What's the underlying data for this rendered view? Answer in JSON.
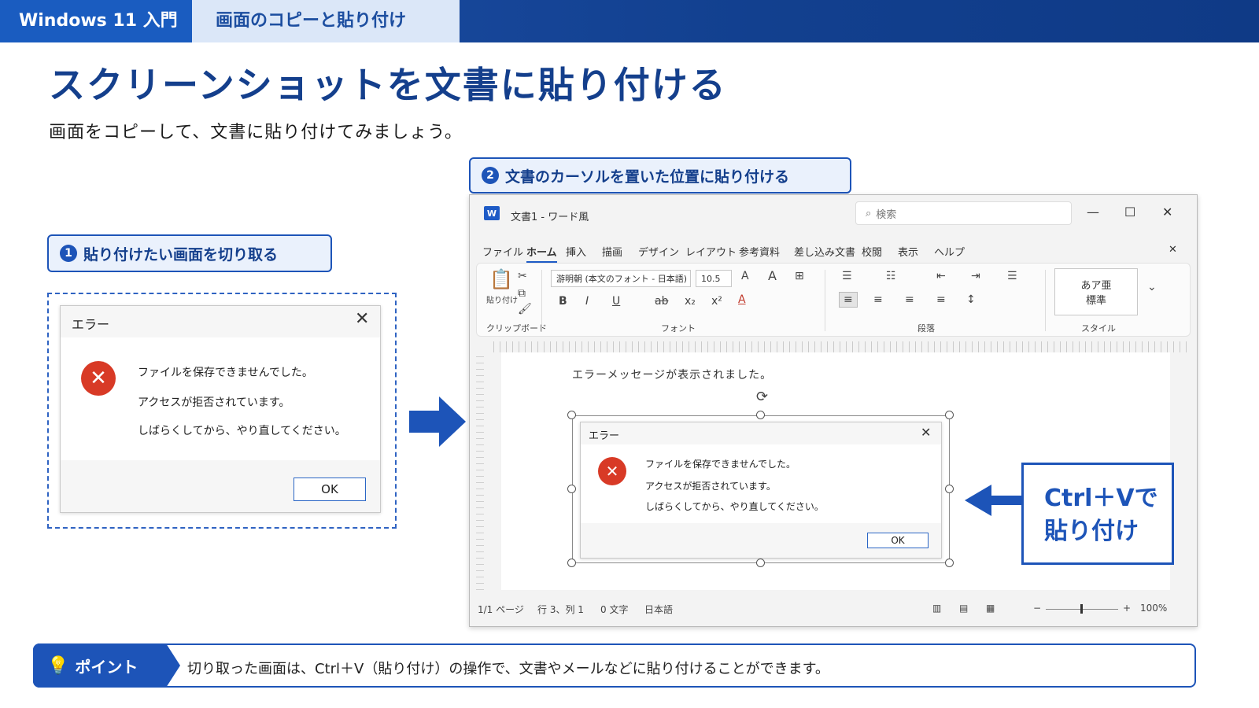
{
  "header": {
    "series": "Windows 11 入門",
    "topic": "画面のコピーと貼り付け"
  },
  "title": "スクリーンショットを文書に貼り付ける",
  "subtitle": "画面をコピーして、文書に貼り付けてみましょう。",
  "step1": {
    "num": "1",
    "label": "貼り付けたい画面を切り取る"
  },
  "step2": {
    "num": "2",
    "label": "文書のカーソルを置いた位置に貼り付ける"
  },
  "error_dialog": {
    "title": "エラー",
    "lines": [
      "ファイルを保存できませんでした。",
      "アクセスが拒否されています。",
      "しばらくしてから、やり直してください。"
    ],
    "ok": "OK"
  },
  "word": {
    "logo": "W",
    "title": "文書1 - ワード風",
    "search_placeholder": "検索",
    "menu": [
      "ファイル",
      "ホーム",
      "挿入",
      "描画",
      "デザイン",
      "レイアウト",
      "参考資料",
      "差し込み文書",
      "校閲",
      "表示",
      "ヘルプ"
    ],
    "ribbon": {
      "paste": "貼り付け",
      "clipboard": "クリップボード",
      "font_name": "游明朝 (本文のフォント - 日本語)",
      "font_size": "10.5",
      "font_group": "フォント",
      "paragraph_group": "段落",
      "style_preview": "あア亜",
      "style_name": "標準",
      "style_group": "スタイル"
    },
    "doc_text": "エラーメッセージが表示されました。",
    "status": {
      "page": "1/1 ページ",
      "pos": "行 3、列 1",
      "words": "0 文字",
      "lang": "日本語",
      "zoom": "100%"
    }
  },
  "callout": {
    "line1": "Ctrl＋Vで",
    "line2": "貼り付け"
  },
  "point": {
    "label": "ポイント",
    "text": "切り取った画面は、Ctrl＋V（貼り付け）の操作で、文書やメールなどに貼り付けることができます。"
  },
  "colors": {
    "brand": "#1d54b8",
    "title": "#143f8c",
    "error": "#d83a26"
  }
}
